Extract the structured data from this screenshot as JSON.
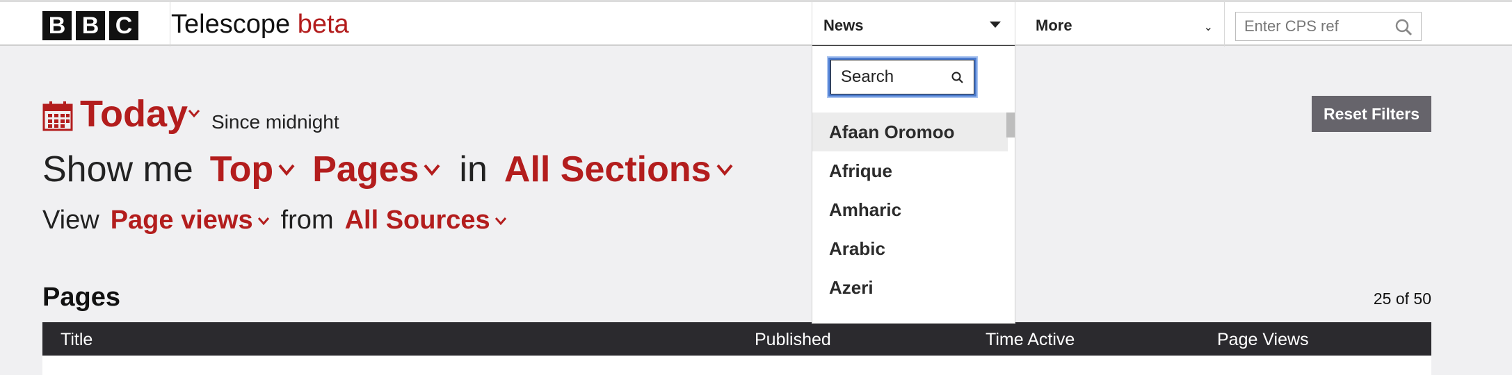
{
  "header": {
    "logo": [
      "B",
      "B",
      "C"
    ],
    "app_title": "Telescope",
    "app_badge": "beta",
    "nav_news": "News",
    "nav_more": "More",
    "cps_placeholder": "Enter CPS ref"
  },
  "dropdown": {
    "search_placeholder": "Search",
    "items": [
      "Afaan Oromoo",
      "Afrique",
      "Amharic",
      "Arabic",
      "Azeri"
    ]
  },
  "filters": {
    "period": "Today",
    "period_note": "Since midnight",
    "show_me": "Show me",
    "rank": "Top",
    "content": "Pages",
    "in": "in",
    "section": "All Sections",
    "view": "View",
    "metric": "Page views",
    "from": "from",
    "source": "All Sources",
    "reset_label": "Reset Filters"
  },
  "results": {
    "heading": "Pages",
    "count": "25 of 50",
    "columns": [
      "Title",
      "Published",
      "Time Active",
      "Page Views"
    ]
  },
  "colors": {
    "accent": "#b31d1d",
    "table_header": "#2b2a2e",
    "reset_button": "#66646b"
  }
}
